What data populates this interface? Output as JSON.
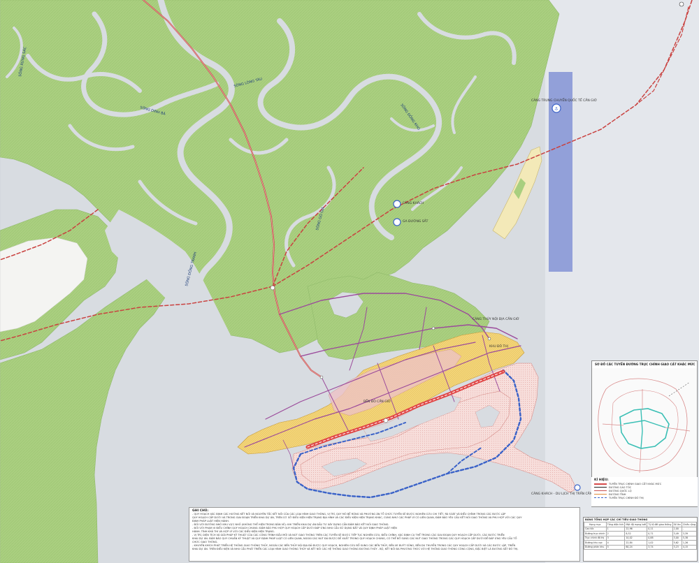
{
  "map": {
    "colors": {
      "water": "#d9dde3",
      "land": "#a9cf7f",
      "urban": "#f1d27a",
      "urban_pink": "#eec6c6",
      "new_district": "#f6d8d4",
      "national_road": "#c85050",
      "provincial_road": "#c04040",
      "urban_road": "#9a4a9a",
      "expressway": "#e04040",
      "planned_axis": "#3a62c8",
      "sea_strip": "#8d9cd8"
    },
    "labels": {
      "river_1": "SÔNG RỪNG SÁC",
      "river_2": "SÔNG LÒNG TÀU",
      "river_3": "SÔNG ĐỒNG TRANH",
      "river_4": "SÔNG ĐỒNG KHO",
      "river_5": "SÔNG NGÃ BẢY",
      "river_6": "SÔNG GÒ GIA",
      "river_7": "SÔNG DINH BÀ",
      "ferry": "CẢNG THỦY NỘI ĐỊA CẦN GIỜ",
      "port_north": "CẢNG TRUNG CHUYỂN QUỐC TẾ CẦN GIỜ",
      "station_1": "CẢNG KHÁCH",
      "station_2": "GA ĐƯỜNG SẮT",
      "town_1": "CẦN THẠNH",
      "town_2": "KHU ĐÔ THỊ",
      "town_3": "BẾN ĐÒ CẦN GIỜ",
      "bottom_port": "CẢNG KHÁCH - DU LỊCH THỊ TRẤN CẦN THẠNH"
    }
  },
  "notes": {
    "title": "GHI CHÚ:",
    "lines": [
      "- QUY HOẠCH XÁC ĐỊNH CÁC HƯỚNG KẾT NỐI VÀ NGUYÊN TẮC KẾT NỐI CỦA CÁC LOẠI HÌNH GIAO THÔNG, VỊ TRÍ, QUY MÔ BỀ RỘNG VÀ PHƯƠNG ÁN TỔ CHỨC TUYẾN SẼ ĐƯỢC NGHIÊN CỨU CHI TIẾT, RÀ SOÁT VÀ ĐIỀU CHỈNH TRONG CÁC BƯỚC LẬP",
      "QUY HOẠCH CẤP DƯỚI VÀ TRONG GIAI ĐOẠN TRIỂN KHAI DỰ ÁN, TRÊN CƠ SỞ ĐIỀU KIỆN HIỆN TRẠNG ĐỊA HÌNH VÀ CÁC ĐIỀU KIỆN HIỆN TRẠNG KHÁC, CÙNG NHƯ CÁC PHÁP LÝ CÓ LIÊN QUAN, ĐẢM BẢO YÊU CẦU KẾT NỐI GIAO THÔNG VÀ PHÙ HỢP VỚI CÁC QUY",
      "ĐỊNH PHÁP LUẬT HIỆN HÀNH.",
      "- ĐỐI VỚI ĐƯỜNG NHỎ KHU VỰC NHỎ (KHÔNG THỂ HIỆN TRONG BẢN VẼ): KHI TRIỂN KHAI DỰ ÁN ĐẦU TƯ XÂY DỰNG CẦN ĐẢM BẢO KẾT NỐI GIAO THÔNG.",
      "- ĐỐI VỚI PHẠM VI ĐIỀU CHỈNH QUY HOẠCH CHUNG: ĐẢM BẢO PHÙ HỢP QUY HOẠCH CẤP DƯỚI ĐÁP ỨNG NHU CẦU SỬ DỤNG ĐẤT VÀ QUY ĐỊNH PHÁP LUẬT HIỆN",
      "HÀNH. TÍNH KHẢ THI VÀ HỢP LÝ VỚI CÁC ĐIỀU KIỆN HIỆN TRẠNG.",
      "- VỊ TRÍ, DIỆN TÍCH VÀ GIẢI PHÁP KỸ THUẬT CỦA CÁC CÔNG TRÌNH ĐẦU MỐI VÀ NÚT GIAO THÔNG TRÊN CÁC TUYẾN SẼ ĐƯỢC TIẾP TỤC NGHIÊN CỨU, ĐIỀU CHỈNH, XÁC ĐỊNH CỤ THỂ TRONG CÁC GIAI ĐOẠN QUY HOẠCH CẤP DƯỚI, CÁC BƯỚC TRIỂN",
      "KHAI DỰ ÁN. ĐẢM BẢO QUY CHUẨN KỸ THUẬT VÀ QUY ĐỊNH PHÁP LUẬT CÓ LIÊN QUAN, NGOÀI CÁC NÚT ĐÃ ĐƯỢC ĐỀ XUẤT TRONG QUY HOẠCH CHUNG, CÓ THỂ BỔ SUNG CÁC NÚT GIAO THÔNG TRONG CÁC QUY HOẠCH CẤP DƯỚI ĐỂ ĐÁP ỨNG YÊU CẦU TỔ",
      "CHỨC GIAO THÔNG.",
      "- KHUYẾN KHÍCH PHÁT TRIỂN HỆ THỐNG GIAO THÔNG THỦY, NGOÀI CÁC BẾN THỦY NỘI ĐỊA ĐÃ ĐƯỢC QUY HOẠCH, NGHIÊN CỨU BỔ SUNG CÁC BẾN THỦY, BẾN XE BUÝT SÔNG, BẾN DU THUYỀN TRONG CÁC QUY HOẠCH CẤP DƯỚI VÀ CÁC BƯỚC LẬP, TRIỂN",
      "KHAI DỰ ÁN. TRÊN ĐIỀU KIỆN VÀ NHU CẦU PHÁT TRIỂN CÁC LOẠI HÌNH GIAO THÔNG THỦY VÀ KẾT NỐI CÁC HỆ THỐNG GIAO THÔNG ĐƯỜNG THỦY - BỘ, KẾT NỐI ĐA PHƯƠNG THỨC VỚI HỆ THỐNG GIAO THÔNG CÔNG CỘNG, ĐẶC BIỆT LÀ ĐƯỜNG SẮT ĐÔ THỊ."
    ]
  },
  "inset": {
    "title": "SƠ ĐỒ CÁC TUYẾN ĐƯỜNG TRỤC CHÍNH GIAO CẮT KHÁC MỨC"
  },
  "legend": {
    "title": "KÍ HIỆU:",
    "items": [
      {
        "label": "TUYẾN TRỤC CHÍNH GIAO CẮT KHÁC MỨC",
        "color": "#d64a4a",
        "style": "solid"
      },
      {
        "label": "ĐƯỜNG CAO TỐC",
        "color": "#222222",
        "style": "solid"
      },
      {
        "label": "ĐƯỜNG QUỐC LỘ",
        "color": "#c85050",
        "style": "solid"
      },
      {
        "label": "ĐƯỜNG TỈNH",
        "color": "#e08a3a",
        "style": "solid"
      },
      {
        "label": "TUYẾN TRỤC CHÍNH ĐÔ THỊ",
        "color": "#3a62c8",
        "style": "dashed"
      }
    ]
  },
  "table": {
    "title": "BẢNG TỔNG HỢP CÁC CHỈ TIÊU GIAO THÔNG",
    "headers": [
      "Hạng mục",
      "Tổng diện tích",
      "Mật độ mạng lưới",
      "Tỷ lệ đất giao thông",
      "Số làn",
      "Chiều rộng"
    ],
    "rows": [
      [
        "Cao tốc",
        "1",
        "22,96",
        "0,11",
        "2,00",
        "-"
      ],
      [
        "Đường trục chính",
        "2",
        "8,52",
        "0,71",
        "3,49",
        "3,39"
      ],
      [
        "Trục chính đô thị",
        "3",
        "10,02",
        "0,88",
        "3,00",
        "5,38"
      ],
      [
        "Đường khu vực",
        "4",
        "22,84",
        "1,02",
        "5,62",
        "1,26"
      ],
      [
        "Đường phân khu",
        "5",
        "60,24",
        "3,74",
        "3,23",
        "4,15"
      ]
    ]
  }
}
